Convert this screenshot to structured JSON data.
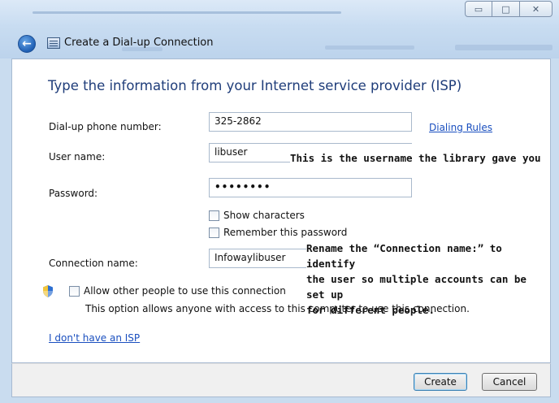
{
  "window": {
    "title": "Create a Dial-up Connection",
    "caption": {
      "minimize": "▭",
      "maximize": "□",
      "close": "✕"
    },
    "back_icon": "arrow-left-icon",
    "app_icon": "dialup-connection-icon"
  },
  "heading": "Type the information from your Internet service provider (ISP)",
  "form": {
    "phone_label": "Dial-up phone number:",
    "phone_value": "325-2862",
    "dialing_rules_link": "Dialing Rules",
    "username_label": "User name:",
    "username_value": "libuser",
    "password_label": "Password:",
    "password_value": "••••••••",
    "show_characters": {
      "label": "Show characters",
      "checked": false
    },
    "remember_password": {
      "label": "Remember this password",
      "checked": false
    },
    "connection_name_label": "Connection name:",
    "connection_name_value": "Infowaylibuser",
    "allow_others": {
      "label": "Allow other people to use this connection",
      "checked": false
    },
    "allow_others_desc": "This option allows anyone with access to this computer to use this connection."
  },
  "annotations": {
    "username_note": "This is the username the library gave you",
    "connection_note_line1": "Rename the “Connection name:” to identify",
    "connection_note_line2": "the user so multiple accounts can be set up",
    "connection_note_line3": "for different people."
  },
  "no_isp_link": "I don't have an ISP",
  "buttons": {
    "create": "Create",
    "cancel": "Cancel"
  },
  "colors": {
    "heading": "#1f3d7a",
    "link": "#1a4fbf",
    "chrome": "#c8dcf1"
  }
}
